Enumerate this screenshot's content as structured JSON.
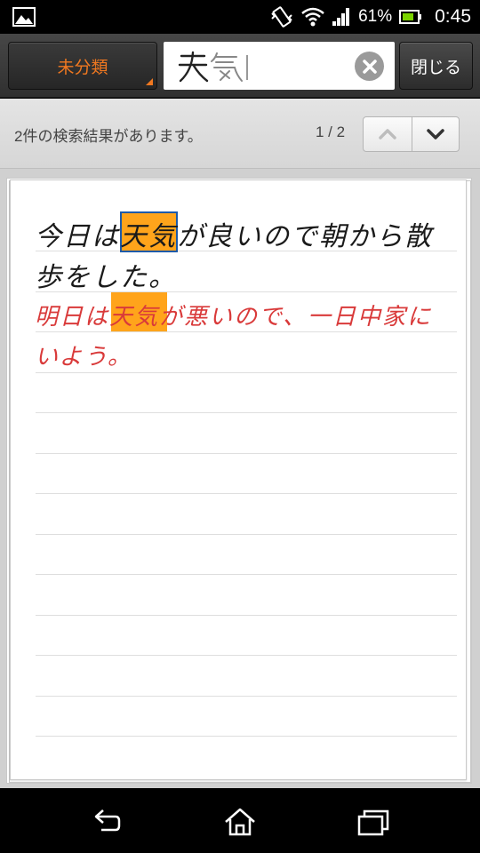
{
  "status_bar": {
    "battery_percent": "61%",
    "time": "0:45",
    "icons": [
      "image-icon",
      "vibrate-icon",
      "wifi-icon",
      "signal-icon",
      "battery-icon"
    ]
  },
  "toolbar": {
    "category_label": "未分類",
    "search_query_handwritten": "天気",
    "close_label": "閉じる",
    "accent_color": "#f07820"
  },
  "results": {
    "message": "2件の検索結果があります。",
    "counter": "1 / 2"
  },
  "note": {
    "lines": [
      {
        "text": "今日は天気が良いので朝から散",
        "ink": "black"
      },
      {
        "text": "歩をした。",
        "ink": "black"
      },
      {
        "text": "明日は天気が悪いので、一日中家に",
        "ink": "red"
      },
      {
        "text": "いよう。",
        "ink": "red"
      }
    ],
    "highlight_color": "#ffa41b",
    "ink_colors": {
      "black": "#1a1a1a",
      "red": "#d93a3a"
    }
  },
  "nav_bar": {
    "icons": [
      "back-icon",
      "home-icon",
      "recent-apps-icon"
    ]
  }
}
